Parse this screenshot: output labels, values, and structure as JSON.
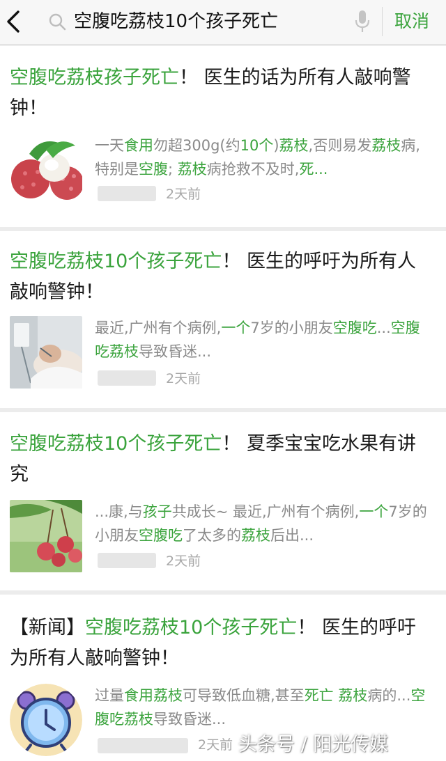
{
  "search": {
    "query": "空腹吃荔枝10个孩子死亡",
    "cancel_label": "取消"
  },
  "colors": {
    "accent": "#3aa33c",
    "snippet_text": "#8a8a8a",
    "time_text": "#a8a8a8",
    "page_bg": "#ececec"
  },
  "results": [
    {
      "title_parts": [
        {
          "t": "空腹吃荔枝孩子死亡",
          "hl": true
        },
        {
          "t": "！ 医生的话为所有人敲响警钟！",
          "hl": false
        }
      ],
      "snippet_parts": [
        {
          "t": "一天",
          "hl": false
        },
        {
          "t": "食用",
          "hl": true
        },
        {
          "t": "勿超300g(约",
          "hl": false
        },
        {
          "t": "10个",
          "hl": true
        },
        {
          "t": ")",
          "hl": false
        },
        {
          "t": "荔枝",
          "hl": true
        },
        {
          "t": ",否则易发",
          "hl": false
        },
        {
          "t": "荔枝",
          "hl": true
        },
        {
          "t": "病,特别是",
          "hl": false
        },
        {
          "t": "空腹",
          "hl": true
        },
        {
          "t": "; ",
          "hl": false
        },
        {
          "t": "荔枝",
          "hl": true
        },
        {
          "t": "病抢救不及时,",
          "hl": false
        },
        {
          "t": "死...",
          "hl": true
        }
      ],
      "time": "2天前",
      "thumb_icon": "lychee-icon"
    },
    {
      "title_parts": [
        {
          "t": "空腹吃荔枝10个孩子死亡",
          "hl": true
        },
        {
          "t": "！ 医生的呼吁为所有人敲响警钟！",
          "hl": false
        }
      ],
      "snippet_parts": [
        {
          "t": "最近,广州有个病例,",
          "hl": false
        },
        {
          "t": "一个",
          "hl": true
        },
        {
          "t": "7岁的小朋友",
          "hl": false
        },
        {
          "t": "空腹吃",
          "hl": true
        },
        {
          "t": "...",
          "hl": false
        },
        {
          "t": "空腹吃荔枝",
          "hl": true
        },
        {
          "t": "导致昏迷...",
          "hl": false
        }
      ],
      "time": "2天前",
      "thumb_icon": "hospital-patient-icon"
    },
    {
      "title_parts": [
        {
          "t": "空腹吃荔枝10个孩子死亡",
          "hl": true
        },
        {
          "t": "！ 夏季宝宝吃水果有讲究",
          "hl": false
        }
      ],
      "snippet_parts": [
        {
          "t": "...康,与",
          "hl": false
        },
        {
          "t": "孩子",
          "hl": true
        },
        {
          "t": "共成长~ 最近,广州有个病例,",
          "hl": false
        },
        {
          "t": "一个",
          "hl": true
        },
        {
          "t": "7岁的小朋友",
          "hl": false
        },
        {
          "t": "空腹吃",
          "hl": true
        },
        {
          "t": "了太多的",
          "hl": false
        },
        {
          "t": "荔枝",
          "hl": true
        },
        {
          "t": "后出...",
          "hl": false
        }
      ],
      "time": "2天前",
      "thumb_icon": "lychee-tree-icon"
    },
    {
      "title_parts": [
        {
          "t": "【新闻】",
          "hl": false
        },
        {
          "t": "空腹吃荔枝10个孩子死亡",
          "hl": true
        },
        {
          "t": "！ 医生的呼吁为所有人敲响警钟！",
          "hl": false
        }
      ],
      "snippet_parts": [
        {
          "t": "过量",
          "hl": false
        },
        {
          "t": "食用荔枝",
          "hl": true
        },
        {
          "t": "可导致低血糖,甚至",
          "hl": false
        },
        {
          "t": "死亡 荔枝",
          "hl": true
        },
        {
          "t": "病的...",
          "hl": false
        },
        {
          "t": "空腹吃荔枝",
          "hl": true
        },
        {
          "t": "导致昏迷...",
          "hl": false
        }
      ],
      "time": "2天前",
      "thumb_icon": "alarm-clock-icon"
    }
  ],
  "watermark": "头条号 / 阳光传媒"
}
